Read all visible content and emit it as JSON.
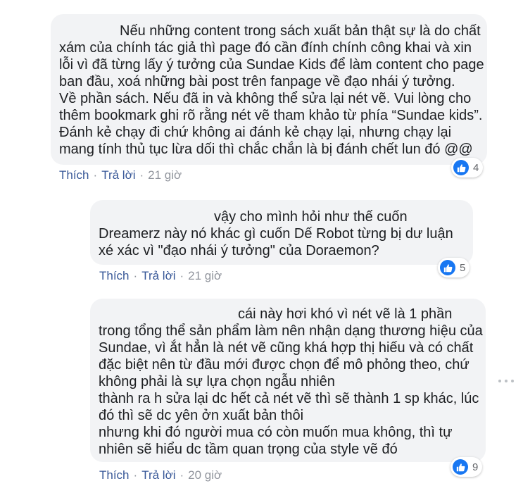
{
  "comments": [
    {
      "lines": [
        "Nếu những content trong sách xuất bản thật sự là do chất",
        "xám của chính tác giả thì page đó cần đính chính công khai và xin",
        "lỗi vì đã từng lấy ý tưởng của Sundae Kids để làm content cho page",
        "ban đầu, xoá những bài post trên fanpage về đạo nhái ý tưởng.",
        "Về phần sách. Nếu đã in và không thể sửa lại nét vẽ. Vui lòng cho",
        "thêm bookmark ghi rõ rằng nét vẽ tham khảo từ phía “Sundae kids”.",
        "Đánh kẻ chạy đi chứ không ai đánh kẻ chạy lại, nhưng chạy lại",
        "mang tính thủ tục lừa dối thì chắc chắn là bị đánh chết lun đó @@"
      ],
      "like": "Thích",
      "reply": "Trả lời",
      "time": "21 giờ",
      "reactions": "4"
    },
    {
      "lines": [
        "vậy cho mình hỏi như thế cuốn",
        "Dreamerz này nó khác gì cuốn Dế Robot từng bị dư luận",
        "xé xác vì \"đạo nhái ý tưởng\" của Doraemon?"
      ],
      "like": "Thích",
      "reply": "Trả lời",
      "time": "21 giờ",
      "reactions": "5"
    },
    {
      "lines": [
        "cái này hơi khó vì nét vẽ là 1 phần",
        "trong tổng thể sản phẩm làm nên nhận dạng thương hiệu của",
        "Sundae, vì ắt hẳn là nét vẽ cũng khá hợp thị hiếu và có chất",
        "đặc biệt nên từ đầu mới được chọn để mô phỏng theo, chứ",
        "không phải là sự lựa chọn ngẫu nhiên",
        "thành ra h sửa lại dc hết cả nét vẽ thì sẽ thành 1 sp khác, lúc",
        "đó thì sẽ dc yên ởn xuất bản thôi",
        "nhưng khi đó người mua có còn muốn mua không, thì tự",
        "nhiên sẽ hiểu dc tầm quan trọng của style vẽ đó"
      ],
      "like": "Thích",
      "reply": "Trả lời",
      "time": "20 giờ",
      "reactions": "9"
    }
  ]
}
